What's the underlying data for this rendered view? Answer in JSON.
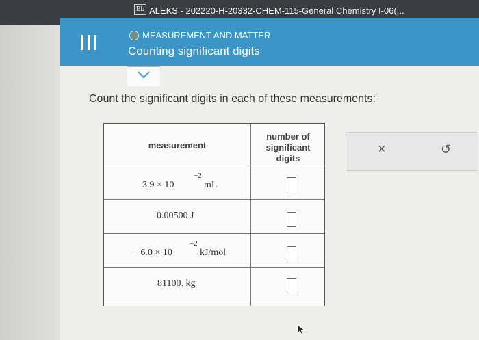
{
  "window": {
    "bb_logo": "Bb",
    "title": "ALEKS - 202220-H-20332-CHEM-115-General Chemistry I-06(..."
  },
  "header": {
    "topic": "MEASUREMENT AND MATTER",
    "subtopic": "Counting significant digits",
    "status_color": "#6f8f86",
    "bg_color": "#3b95c7"
  },
  "main": {
    "instruction": "Count the significant digits in each of these measurements:",
    "table": {
      "headers": [
        "measurement",
        "number of significant digits"
      ],
      "rows": [
        {
          "coefficient": "3.9",
          "times": "×",
          "base": "10",
          "exponent": "−2",
          "unit": "mL",
          "answer": ""
        },
        {
          "value": "0.00500",
          "unit": "J",
          "answer": ""
        },
        {
          "sign": "−",
          "coefficient": "6.0",
          "times": "×",
          "base": "10",
          "exponent": "−2",
          "unit": "kJ/mol",
          "answer": ""
        },
        {
          "value": "81100.",
          "unit": "kg",
          "answer": ""
        }
      ]
    }
  },
  "actions": {
    "clear_icon": "x-icon",
    "clear_glyph": "×",
    "undo_icon": "undo-icon",
    "undo_glyph": "↺"
  }
}
